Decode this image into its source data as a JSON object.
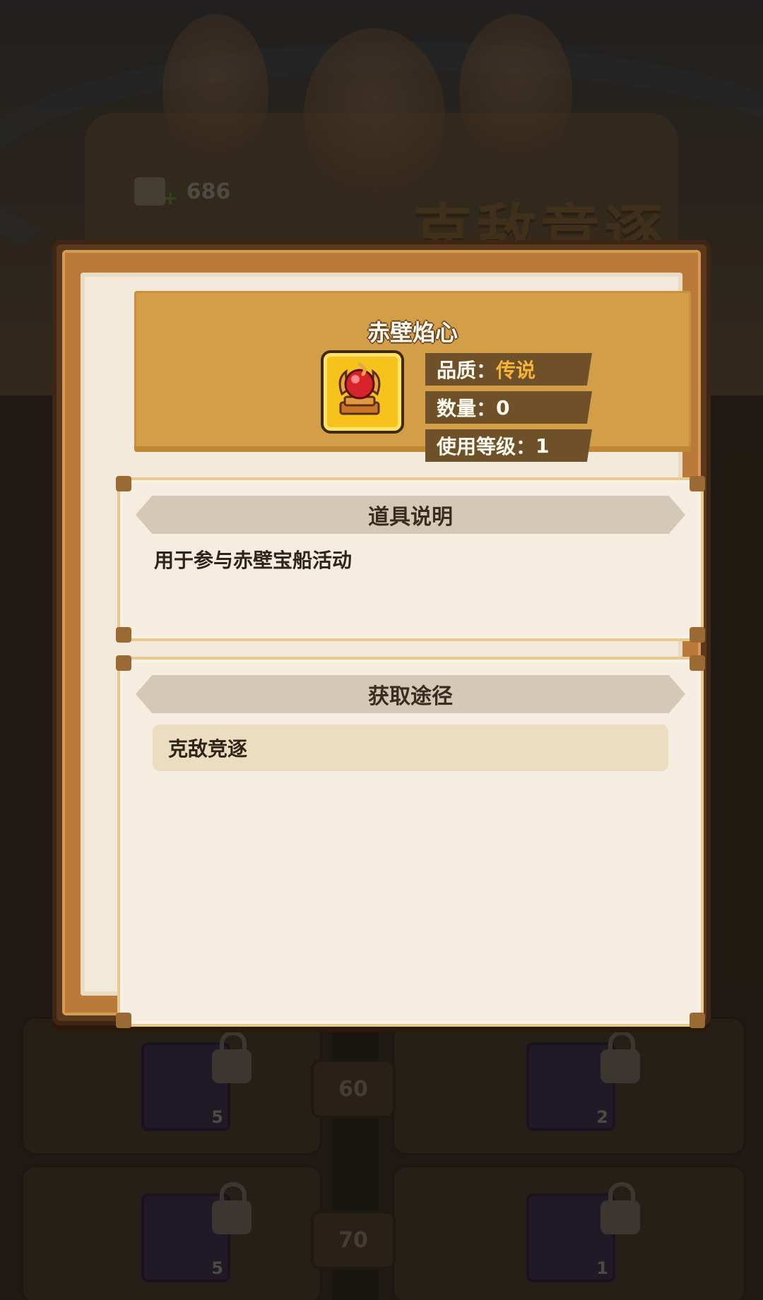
{
  "background": {
    "currency_value": "686",
    "event_title": "克敌竞逐",
    "level_badges": [
      "60",
      "70"
    ],
    "slot_counts": [
      "5",
      "2",
      "5",
      "1"
    ]
  },
  "dialog": {
    "item_name": "赤壁焰心",
    "quality_label": "品质：",
    "quality_value": "传说",
    "quantity_label": "数量：",
    "quantity_value": "0",
    "level_label": "使用等级：",
    "level_value": "1",
    "description": {
      "title": "道具说明",
      "text": "用于参与赤壁宝船活动"
    },
    "sources": {
      "title": "获取途径",
      "items": [
        "克敌竞逐"
      ]
    }
  },
  "colors": {
    "quality_legendary": "#f7b23a",
    "banner": "#d39e48",
    "parchment": "#f1eadb"
  }
}
